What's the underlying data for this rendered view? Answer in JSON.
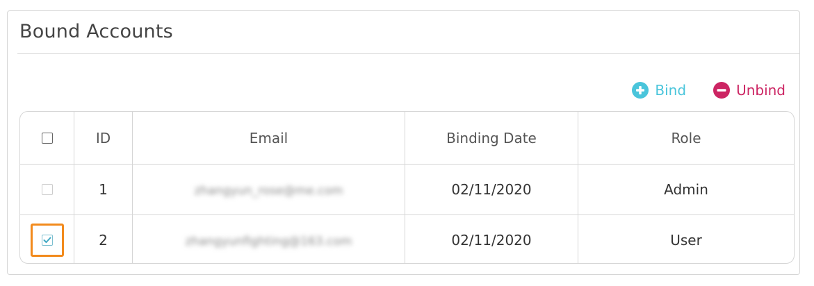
{
  "panel": {
    "title": "Bound Accounts"
  },
  "actions": {
    "bind_label": "Bind",
    "unbind_label": "Unbind",
    "bind_icon": "plus-circle-icon",
    "unbind_icon": "minus-circle-icon"
  },
  "colors": {
    "bind": "#4ac5db",
    "unbind": "#cc2563",
    "highlight": "#f28a1c"
  },
  "table": {
    "headers": {
      "id": "ID",
      "email": "Email",
      "binding_date": "Binding Date",
      "role": "Role"
    },
    "rows": [
      {
        "id": "1",
        "email": "zhangyun_rose@me.com",
        "binding_date": "02/11/2020",
        "role": "Admin",
        "checked": false,
        "disabled": true
      },
      {
        "id": "2",
        "email": "zhangyunfighting@163.com",
        "binding_date": "02/11/2020",
        "role": "User",
        "checked": true,
        "disabled": false
      }
    ]
  }
}
